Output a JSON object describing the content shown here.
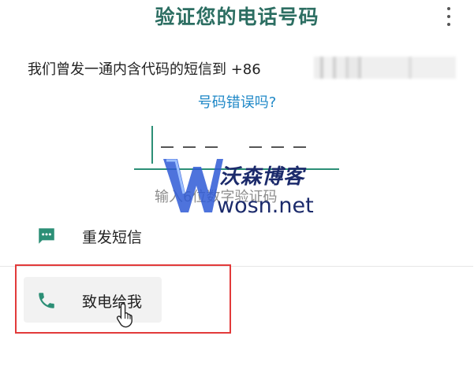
{
  "header": {
    "title": "验证您的电话号码",
    "menu_icon": "more-vert-icon"
  },
  "verify": {
    "sent_text": "我们曾发一通内含代码的短信到 +86",
    "phone_number_masked": true,
    "wrong_number_link": "号码错误吗?",
    "code_placeholder": "--- ---",
    "hint": "输入6位数字验证码"
  },
  "options": [
    {
      "label": "重发短信",
      "icon": "message-icon"
    },
    {
      "label": "致电给我",
      "icon": "phone-icon"
    }
  ],
  "watermark": {
    "brand": "沃森博客",
    "url": "wosn.net"
  },
  "colors": {
    "accent": "#2c8f76",
    "title": "#2c6e62",
    "link": "#1f88c7",
    "highlight": "#e23a3a"
  }
}
